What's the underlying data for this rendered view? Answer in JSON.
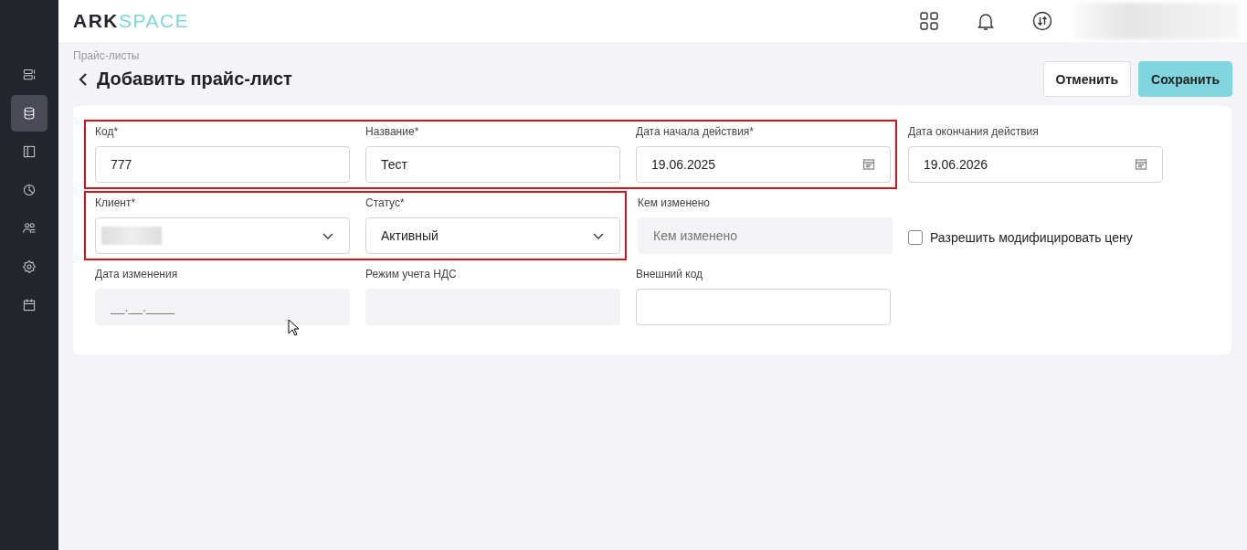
{
  "header": {
    "logo_left": "ARK",
    "logo_right": "SPACE"
  },
  "sidebar": {
    "items": [
      {
        "selected": false
      },
      {
        "selected": true
      },
      {
        "selected": false
      },
      {
        "selected": false
      },
      {
        "selected": false
      },
      {
        "selected": false
      },
      {
        "selected": false
      }
    ]
  },
  "breadcrumb": "Прайс-листы",
  "title": "Добавить прайс-лист",
  "buttons": [
    {
      "label": "Отменить",
      "kind": "secondary"
    },
    {
      "label": "Сохранить",
      "kind": "primary"
    }
  ],
  "rows": [
    {
      "groups": [
        {
          "highlighted": true,
          "fields": [
            {
              "kind": "text",
              "label": "Код*",
              "value": "777"
            },
            {
              "kind": "text",
              "label": "Название*",
              "value": "Тест"
            },
            {
              "kind": "date",
              "label": "Дата начала действия*",
              "value": "19.06.2025"
            }
          ]
        },
        {
          "fields": [
            {
              "kind": "date",
              "label": "Дата окончания действия",
              "value": "19.06.2026"
            }
          ]
        }
      ]
    },
    {
      "groups": [
        {
          "highlighted": true,
          "fields": [
            {
              "kind": "select",
              "label": "Клиент*",
              "redacted": true
            },
            {
              "kind": "select",
              "label": "Статус*",
              "value": "Активный"
            }
          ]
        },
        {
          "fields": [
            {
              "kind": "readonly",
              "label": "Кем изменено",
              "placeholder": "Кем изменено"
            },
            {
              "kind": "checkbox",
              "label": "Разрешить модифицировать цену",
              "checked": false
            }
          ]
        }
      ]
    },
    {
      "groups": [
        {
          "fields": [
            {
              "kind": "readonly",
              "label": "Дата изменения",
              "placeholder": "__.__.____"
            },
            {
              "kind": "readonly",
              "label": "Режим учета НДС"
            },
            {
              "kind": "text",
              "label": "Внешний код"
            }
          ]
        }
      ]
    }
  ]
}
